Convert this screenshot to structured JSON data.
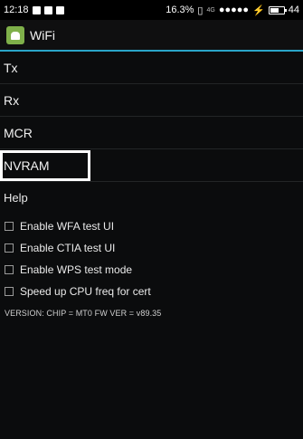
{
  "status_bar": {
    "time": "12:18",
    "battery_percent": "16.3%",
    "network": "4G",
    "signal": "●●●●●",
    "right_number": "44"
  },
  "action_bar": {
    "title": "WiFi"
  },
  "menu": {
    "items": [
      {
        "label": "Tx"
      },
      {
        "label": "Rx"
      },
      {
        "label": "MCR"
      },
      {
        "label": "NVRAM"
      }
    ]
  },
  "help": {
    "label": "Help",
    "options": [
      {
        "label": "Enable WFA test UI",
        "checked": false
      },
      {
        "label": "Enable CTIA test UI",
        "checked": false
      },
      {
        "label": "Enable WPS test mode",
        "checked": false
      },
      {
        "label": "Speed up CPU freq for cert",
        "checked": false
      }
    ]
  },
  "version": "VERSION: CHIP = MT0  FW VER = v89.35",
  "colors": {
    "background": "#0b0c0d",
    "accent_line": "#2aa5c8",
    "app_icon": "#7fb04a"
  }
}
